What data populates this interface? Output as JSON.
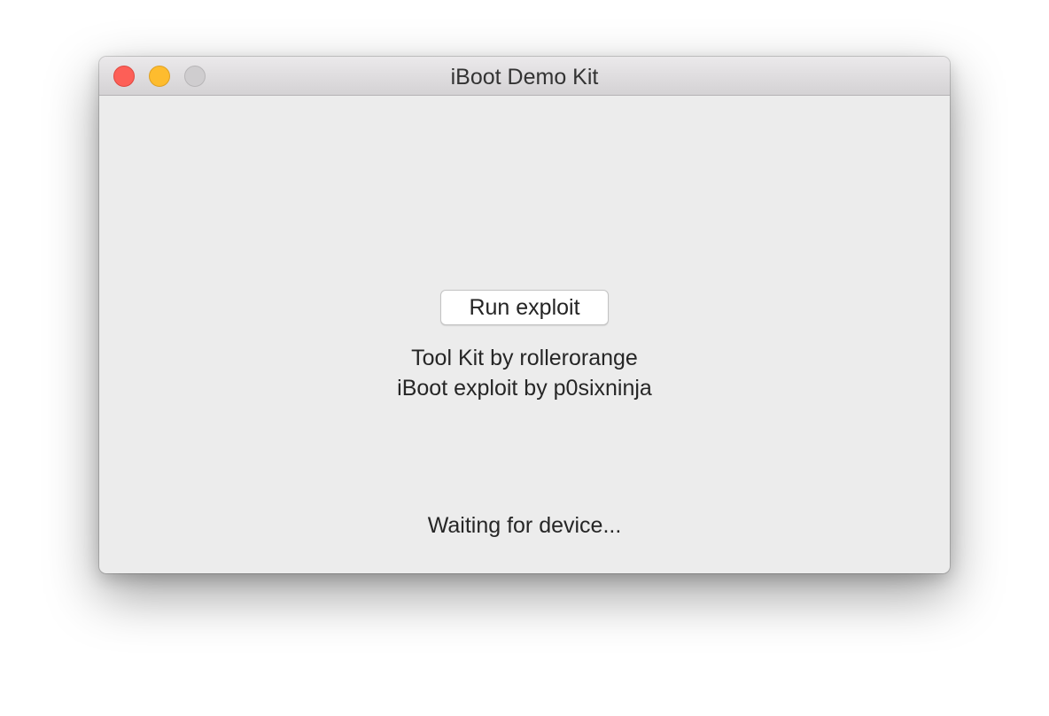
{
  "window": {
    "title": "iBoot Demo Kit",
    "traffic_lights": {
      "close_color": "#fd5f57",
      "minimize_color": "#febc2e",
      "zoom_color": "#cfcdcf"
    }
  },
  "main": {
    "run_button_label": "Run exploit",
    "credits": [
      "Tool Kit by rollerorange",
      "iBoot exploit by p0sixninja"
    ],
    "status_text": "Waiting for device..."
  }
}
